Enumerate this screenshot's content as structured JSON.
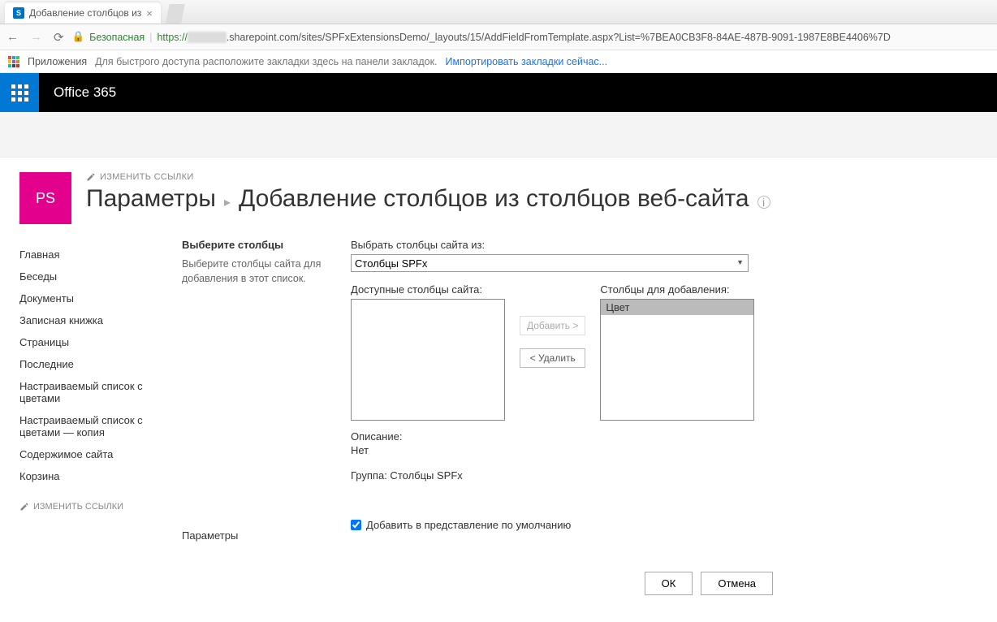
{
  "browser": {
    "tab_title": "Добавление столбцов из",
    "secure_label": "Безопасная",
    "url_proto": "https://",
    "url_host": ".sharepoint.com",
    "url_path": "/sites/SPFxExtensionsDemo/_layouts/15/AddFieldFromTemplate.aspx?List=%7BEA0CB3F8-84AE-487B-9091-1987E8BE4406%7D",
    "apps_label": "Приложения",
    "bookmarks_hint": "Для быстрого доступа расположите закладки здесь на панели закладок.",
    "bookmarks_link": "Импортировать закладки сейчас..."
  },
  "suite": {
    "brand": "Office 365"
  },
  "header": {
    "site_initials": "PS",
    "edit_links": "ИЗМЕНИТЬ ССЫЛКИ",
    "title_left": "Параметры",
    "title_right": "Добавление столбцов из столбцов веб-сайта"
  },
  "nav": {
    "items": [
      "Главная",
      "Беседы",
      "Документы",
      "Записная книжка",
      "Страницы",
      "Последние",
      "Настраиваемый список с цветами",
      "Настраиваемый список с цветами — копия",
      "Содержимое сайта",
      "Корзина"
    ],
    "edit_links": "ИЗМЕНИТЬ ССЫЛКИ"
  },
  "section1": {
    "heading": "Выберите столбцы",
    "description": "Выберите столбцы сайта для добавления в этот список.",
    "select_from_label": "Выбрать столбцы сайта из:",
    "select_from_value": "Столбцы SPFx",
    "available_label": "Доступные столбцы сайта:",
    "to_add_label": "Столбцы для добавления:",
    "to_add_items": [
      "Цвет"
    ],
    "add_btn": "Добавить >",
    "remove_btn": "< Удалить",
    "desc_label": "Описание:",
    "desc_value": "Нет",
    "group_line": "Группа:  Столбцы SPFx"
  },
  "section2": {
    "heading": "Параметры",
    "checkbox_label": "Добавить в представление по умолчанию"
  },
  "footer": {
    "ok": "ОК",
    "cancel": "Отмена"
  }
}
